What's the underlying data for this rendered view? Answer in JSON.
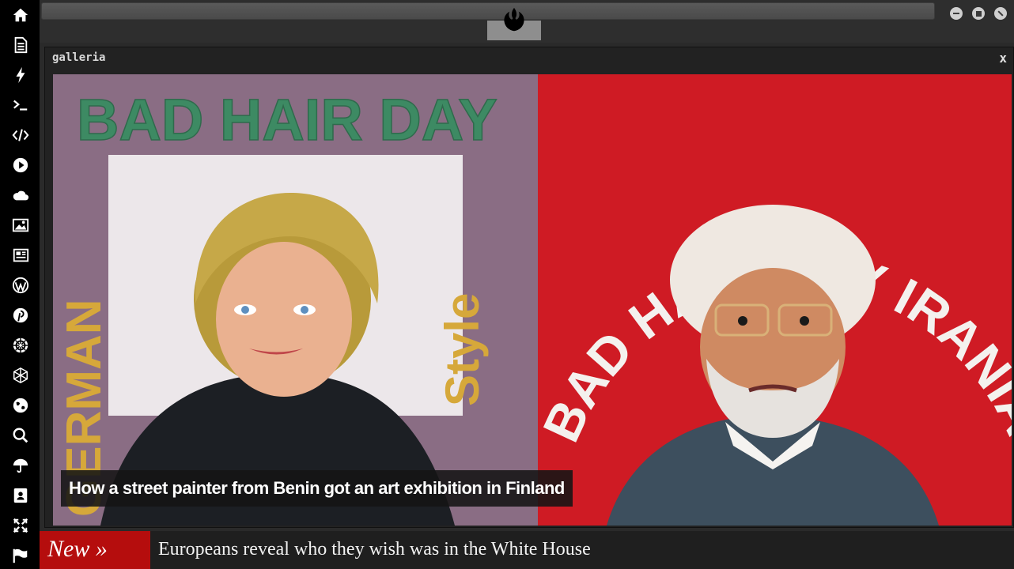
{
  "sidebar": {
    "items": [
      {
        "icon": "home-icon"
      },
      {
        "icon": "document-icon"
      },
      {
        "icon": "lightning-icon"
      },
      {
        "icon": "terminal-icon"
      },
      {
        "icon": "code-icon"
      },
      {
        "icon": "play-icon"
      },
      {
        "icon": "cloud-icon"
      },
      {
        "icon": "image-icon"
      },
      {
        "icon": "newspaper-icon"
      },
      {
        "icon": "wordpress-icon"
      },
      {
        "icon": "pinterest-icon"
      },
      {
        "icon": "empire-icon"
      },
      {
        "icon": "network-icon"
      },
      {
        "icon": "globe-icon"
      },
      {
        "icon": "search-icon"
      },
      {
        "icon": "umbrella-icon"
      },
      {
        "icon": "contact-card-icon"
      },
      {
        "icon": "expand-icon"
      },
      {
        "icon": "flag-icon"
      }
    ]
  },
  "topbar": {
    "logo_icon": "rebel-alliance-icon",
    "window_controls": [
      "minimize",
      "maximize",
      "close"
    ]
  },
  "gallery": {
    "title": "galleria",
    "close_label": "x",
    "caption": "How a street painter from Benin got an art exhibition in Finland",
    "painting": {
      "left_headline": "BAD HAIR DAY",
      "left_side_text": "GERMAN",
      "left_side_text_right": "Style",
      "right_arc_text": "BAD HAIR DAY IRANIAN STYLE"
    }
  },
  "ticker": {
    "badge": "New »",
    "headline": "Europeans reveal who they wish was in the White House"
  },
  "colors": {
    "sidebar_bg": "#000000",
    "ticker_badge": "#b50d0d",
    "painting_left_bg": "#8a6d84",
    "painting_right_bg": "#cf1b24",
    "painting_green_text": "#3d8a63"
  }
}
